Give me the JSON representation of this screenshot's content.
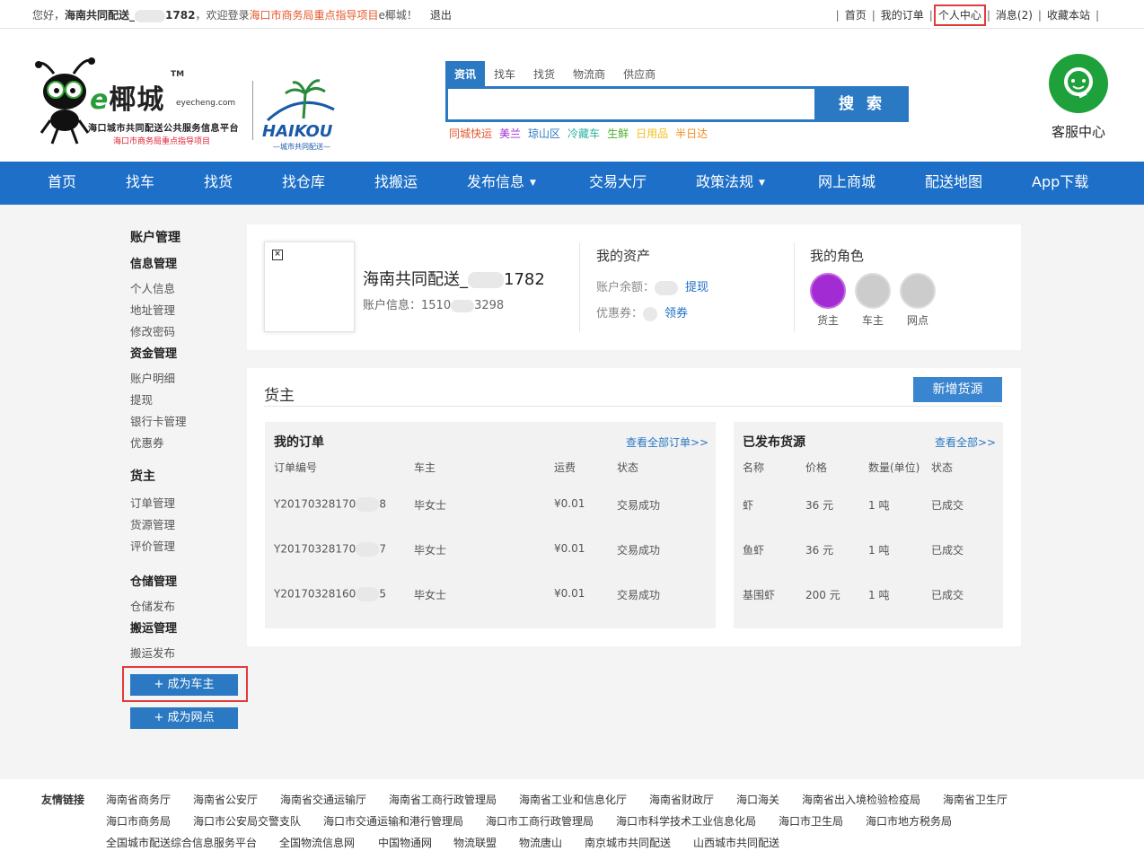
{
  "topbar": {
    "greeting": "您好，",
    "user": "海南共同配送_",
    "user_suffix": "1782",
    "welcome": "，欢迎登录",
    "org": "海口市商务局重点指导项目",
    "site": "e椰城！",
    "logout": "退出",
    "links": [
      "首页",
      "我的订单",
      "个人中心",
      "消息(2)",
      "收藏本站"
    ]
  },
  "brand": {
    "name": "椰城",
    "e": "e",
    "tm": "TM",
    "domain": "eyecheng.com",
    "platform": "海口城市共同配送公共服务信息平台",
    "sub": "海口市商务局重点指导项目",
    "haikou": "HAIKOU",
    "haikou_sub": "—城市共同配送—"
  },
  "search": {
    "tabs": [
      "资讯",
      "找车",
      "找货",
      "物流商",
      "供应商"
    ],
    "button": "搜 索",
    "placeholder": "",
    "hotwords": [
      {
        "t": "同城快运",
        "c": "#e4572e"
      },
      {
        "t": "美兰",
        "c": "#a32bd4"
      },
      {
        "t": "琼山区",
        "c": "#2b79c2"
      },
      {
        "t": "冷藏车",
        "c": "#29b3a0"
      },
      {
        "t": "生鲜",
        "c": "#4caf2a"
      },
      {
        "t": "日用品",
        "c": "#f0c020"
      },
      {
        "t": "半日达",
        "c": "#f08a20"
      }
    ]
  },
  "service": {
    "label": "客服中心"
  },
  "nav": [
    "首页",
    "找车",
    "找货",
    "找仓库",
    "找搬运",
    "发布信息",
    "交易大厅",
    "政策法规",
    "网上商城",
    "配送地图",
    "App下载"
  ],
  "sidebar": {
    "title": "账户管理",
    "groups": [
      {
        "h": "信息管理",
        "items": [
          "个人信息",
          "地址管理",
          "修改密码"
        ]
      },
      {
        "h": "资金管理",
        "items": [
          "账户明细",
          "提现",
          "银行卡管理",
          "优惠券"
        ]
      },
      {
        "h": "货主",
        "items": [
          "订单管理",
          "货源管理",
          "评价管理"
        ]
      },
      {
        "h": "仓储管理",
        "items": [
          "仓储发布"
        ]
      },
      {
        "h": "搬运管理",
        "items": [
          "搬运发布"
        ]
      }
    ],
    "btn_car": "+ 成为车主",
    "btn_net": "+ 成为网点"
  },
  "profile": {
    "name_a": "海南共同配送_",
    "name_b": "1782",
    "info_label": "账户信息：",
    "phone_a": "1510",
    "phone_b": "3298"
  },
  "assets": {
    "title": "我的资产",
    "balance_label": "账户余额：",
    "withdraw": "提现",
    "coupon_label": "优惠券：",
    "get_coupon": "领券"
  },
  "roles": {
    "title": "我的角色",
    "items": [
      "货主",
      "车主",
      "网点"
    ]
  },
  "shipper": {
    "title": "货主",
    "add_btn": "新增货源",
    "orders": {
      "title": "我的订单",
      "more": "查看全部订单>>",
      "headers": [
        "订单编号",
        "车主",
        "运费",
        "状态"
      ],
      "rows": [
        [
          "Y20170328170",
          "毕女士",
          "¥0.01",
          "交易成功",
          "8"
        ],
        [
          "Y20170328170",
          "毕女士",
          "¥0.01",
          "交易成功",
          "7"
        ],
        [
          "Y20170328160",
          "毕女士",
          "¥0.01",
          "交易成功",
          "5"
        ]
      ]
    },
    "goods": {
      "title": "已发布货源",
      "more": "查看全部>>",
      "headers": [
        "名称",
        "价格",
        "数量(单位)",
        "状态"
      ],
      "rows": [
        [
          "虾",
          "36 元",
          "1 吨",
          "已成交"
        ],
        [
          "鱼虾",
          "36 元",
          "1 吨",
          "已成交"
        ],
        [
          "基围虾",
          "200 元",
          "1 吨",
          "已成交"
        ]
      ]
    }
  },
  "footer": {
    "label": "友情链接",
    "rows": [
      [
        "海南省商务厅",
        "海南省公安厅",
        "海南省交通运输厅",
        "海南省工商行政管理局",
        "海南省工业和信息化厅",
        "海南省财政厅",
        "海口海关",
        "海南省出入境检验检疫局",
        "海南省卫生厅"
      ],
      [
        "海口市商务局",
        "海口市公安局交警支队",
        "海口市交通运输和港行管理局",
        "海口市工商行政管理局",
        "海口市科学技术工业信息化局",
        "海口市卫生局",
        "海口市地方税务局"
      ],
      [
        "全国城市配送综合信息服务平台",
        "全国物流信息网",
        "中国物通网",
        "物流联盟",
        "物流唐山",
        "南京城市共同配送",
        "山西城市共同配送"
      ]
    ]
  }
}
